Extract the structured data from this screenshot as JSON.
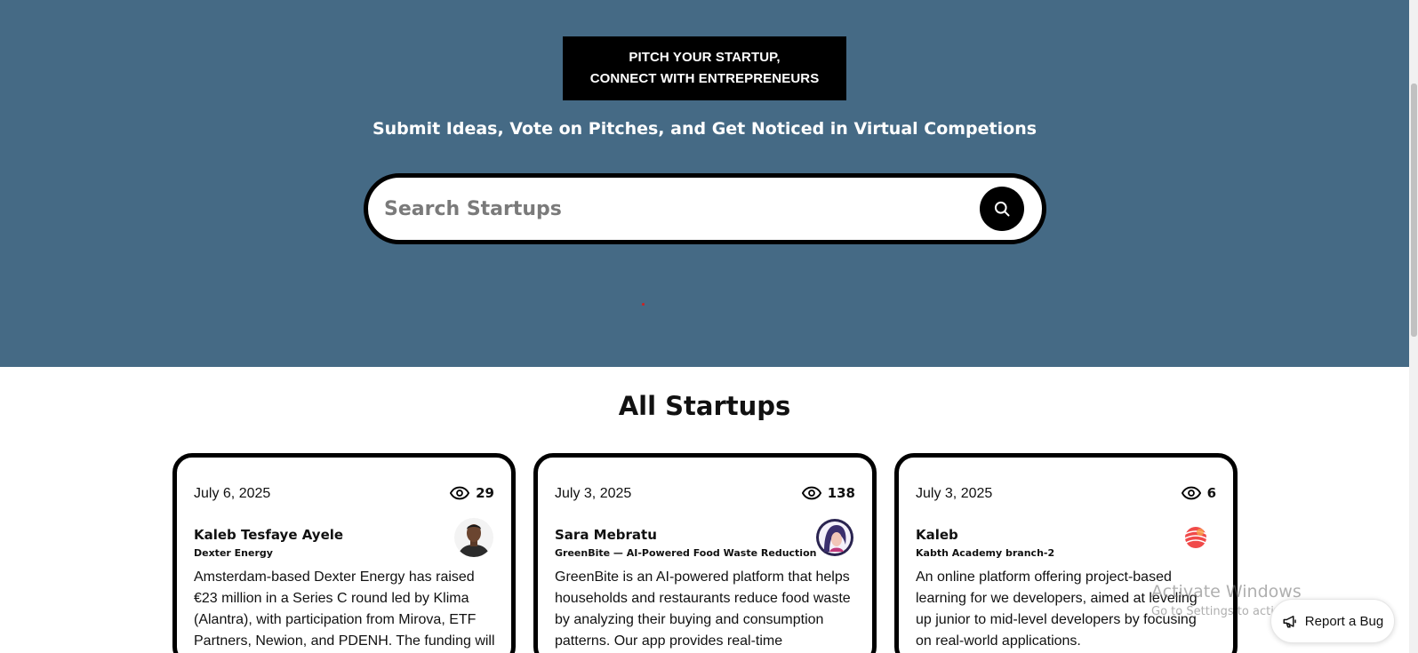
{
  "hero": {
    "pitch_line1": "PITCH YOUR STARTUP,",
    "pitch_line2": "CONNECT WITH ENTREPRENEURS",
    "subtitle": "Submit Ideas, Vote on Pitches, and Get Noticed in Virtual Competions",
    "background_color": "#456a85"
  },
  "search": {
    "placeholder": "Search Startups",
    "button_icon": "search-icon"
  },
  "section": {
    "title": "All Startups"
  },
  "cards": [
    {
      "date": "July 6, 2025",
      "views": "29",
      "author": "Kaleb Tesfaye Ayele",
      "company": "Dexter Energy",
      "avatar": "person-photo-avatar",
      "desc_lines": [
        "Amsterdam-based Dexter Energy has raised",
        "€23 million in a Series C round led by Klima",
        "(Alantra), with participation from Mirova, ETF",
        "Partners, Newion, and PDENH. The funding will"
      ]
    },
    {
      "date": "July 3, 2025",
      "views": "138",
      "author": "Sara Mebratu",
      "company": "GreenBite — AI-Powered Food Waste Reduction",
      "avatar": "illustrated-woman-avatar",
      "desc_lines": [
        "GreenBite is an AI-powered platform that helps",
        "households and restaurants reduce food waste",
        "by analyzing their buying and consumption",
        "patterns. Our app provides real-time"
      ]
    },
    {
      "date": "July 3, 2025",
      "views": "6",
      "author": "Kaleb",
      "company": "Kabth Academy branch-2",
      "avatar": "sphere-logo-avatar",
      "desc_lines": [
        "An online platform offering project-based",
        "learning for we developers, aimed at leveling",
        "up junior to mid-level developers by focusing",
        "on real-world applications."
      ]
    }
  ],
  "watermark": {
    "line1": "Activate Windows",
    "line2": "Go to Settings to activate Windows."
  },
  "bug_button": {
    "label": "Report a Bug",
    "icon": "megaphone-icon"
  }
}
